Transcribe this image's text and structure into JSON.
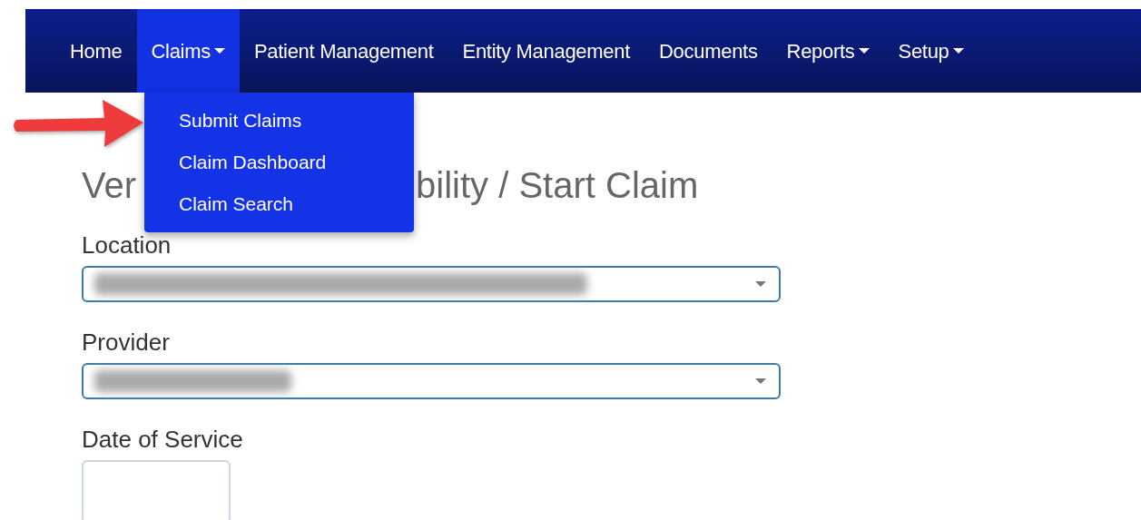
{
  "navbar": {
    "items": [
      {
        "label": "Home",
        "has_menu": false,
        "selected": false
      },
      {
        "label": "Claims",
        "has_menu": true,
        "selected": true
      },
      {
        "label": "Patient Management",
        "has_menu": false,
        "selected": false
      },
      {
        "label": "Entity Management",
        "has_menu": false,
        "selected": false
      },
      {
        "label": "Documents",
        "has_menu": false,
        "selected": false
      },
      {
        "label": "Reports",
        "has_menu": true,
        "selected": false
      },
      {
        "label": "Setup",
        "has_menu": true,
        "selected": false
      }
    ]
  },
  "dropdown": {
    "items": [
      {
        "label": "Submit Claims"
      },
      {
        "label": "Claim Dashboard"
      },
      {
        "label": "Claim Search"
      }
    ]
  },
  "annotation": {
    "kind": "arrow"
  },
  "heading_parts": [
    "Ver",
    "bility / Start Claim"
  ],
  "fields": [
    {
      "kind": "select",
      "label": "Location",
      "value_redacted": true
    },
    {
      "kind": "select",
      "label": "Provider",
      "value_redacted": true
    },
    {
      "kind": "date",
      "label": "Date of Service"
    }
  ]
}
